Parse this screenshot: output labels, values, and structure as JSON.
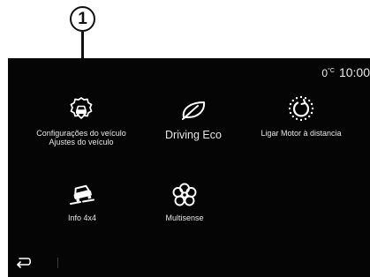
{
  "callout": {
    "number": "1"
  },
  "status": {
    "temperature": "0°C",
    "temp_value": "0",
    "temp_unit": "°C",
    "time": "10:00"
  },
  "apps": [
    {
      "label_line1": "Configurações do veículo",
      "label_line2": "Ajustes do veículo",
      "icon": "vehicle-settings-icon"
    },
    {
      "label": "Driving Eco",
      "icon": "leaf-icon"
    },
    {
      "label": "Ligar Motor à distancia",
      "icon": "remote-start-icon"
    },
    {
      "label": "Info 4x4",
      "icon": "4x4-info-icon"
    },
    {
      "label": "Multisense",
      "icon": "multisense-flower-icon"
    }
  ],
  "nav": {
    "back_icon": "back-arrow-icon"
  },
  "colors": {
    "screen_bg": "#050505",
    "icon": "#ffffff",
    "text": "#e6e6e6"
  }
}
